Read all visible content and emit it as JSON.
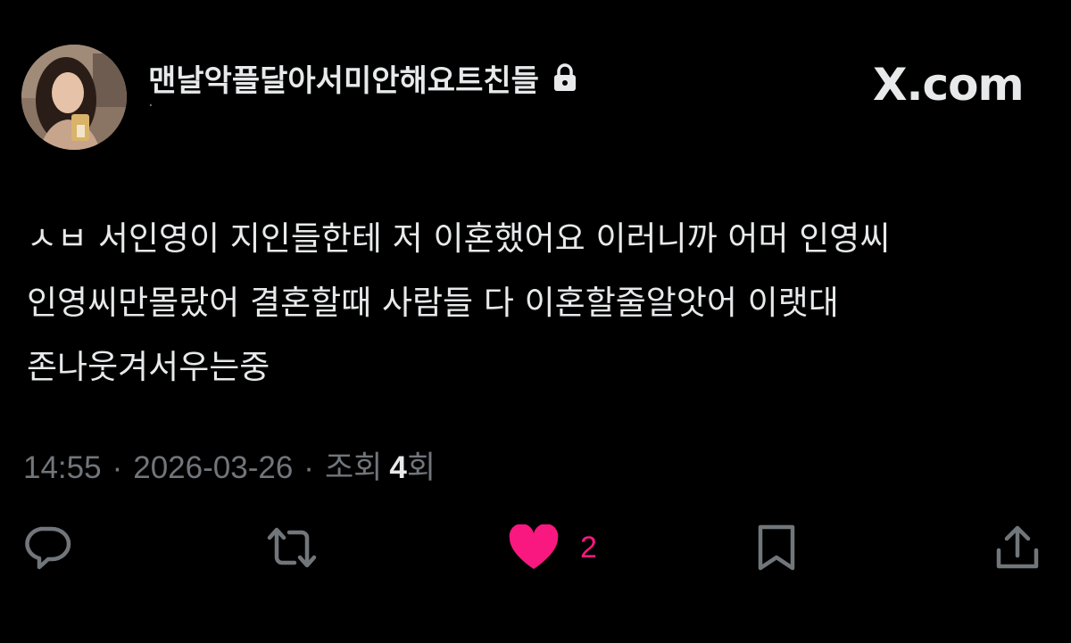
{
  "header": {
    "display_name": "맨날악플달아서미안해요트친들",
    "handle": "·",
    "lock_icon": "lock-icon",
    "brand": "X.com"
  },
  "tweet": {
    "text": "ㅅㅂ 서인영이 지인들한테 저 이혼했어요 이러니까 어머 인영씨 인영씨만몰랐어 결혼할때 사람들 다 이혼할줄알앗어 이랫대 존나웃겨서우는중"
  },
  "meta": {
    "time": "14:55",
    "separator": "·",
    "date": "2026-03-26",
    "views_label": "조회",
    "views_count": "4",
    "views_suffix": "회"
  },
  "actions": {
    "reply_icon": "reply-icon",
    "retweet_icon": "retweet-icon",
    "like_icon": "heart-icon",
    "like_count": "2",
    "bookmark_icon": "bookmark-icon",
    "share_icon": "share-icon"
  },
  "colors": {
    "background": "#000000",
    "text": "#e7e9ea",
    "muted": "#71767b",
    "like": "#f91880"
  }
}
